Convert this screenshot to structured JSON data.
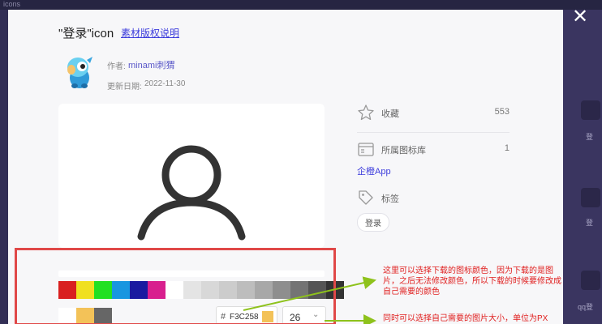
{
  "background": {
    "tab_label": "icons",
    "right_labels": [
      "登",
      "登",
      "qq登"
    ]
  },
  "modal": {
    "title": "\"登录\"icon",
    "license_link": "素材版权说明",
    "author_label": "作者:",
    "author_name": "minami刺猬",
    "date_label": "更新日期:",
    "date_value": "2022-11-30",
    "close_icon": "close-icon"
  },
  "stats": {
    "favorites_label": "收藏",
    "favorites_count": "553",
    "library_label": "所属图标库",
    "library_count": "1",
    "library_name": "企橙App",
    "tags_label": "标签",
    "tags": [
      "登录"
    ]
  },
  "colors": {
    "palette": [
      "#d92020",
      "#f0e020",
      "#22e022",
      "#1896e0",
      "#1a1aa0",
      "#d81f8e",
      "#ffffff",
      "#e4e4e4",
      "#d8d8d8",
      "#cccccc",
      "#bdbdbd",
      "#a8a8a8",
      "#8e8e8e",
      "#747474",
      "#555555",
      "#333333"
    ],
    "selected": [
      "#ffffff",
      "#f3c258",
      "#666666"
    ],
    "hex_hash": "#",
    "hex_value": "F3C258",
    "hex_chip": "#f3c258",
    "size_value": "26",
    "size_chevron": "⌄"
  },
  "annotations": {
    "note1": "这里可以选择下载的图标颜色，因为下载的是图片，之后无法修改颜色，所以下载的时候要修改成自己需要的颜色",
    "note2": "同时可以选择自己需要的图片大小，单位为PX",
    "color": "#e02020"
  }
}
